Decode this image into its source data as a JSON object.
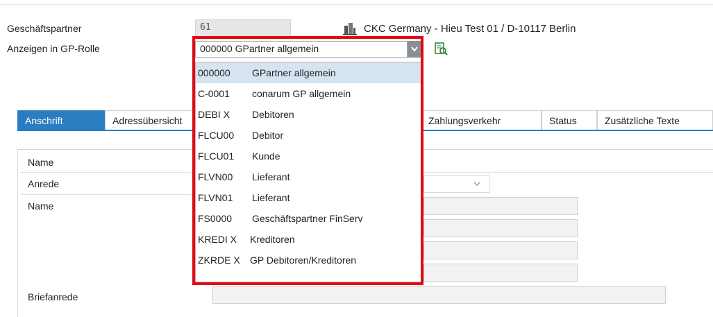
{
  "header": {
    "partner_label": "Geschäftspartner",
    "partner_value": "61",
    "partner_name": "CKC Germany - Hieu Test 01 / D-10117 Berlin",
    "role_label": "Anzeigen in GP-Rolle",
    "role_selected": "000000 GPartner allgemein"
  },
  "dropdown": {
    "options": [
      {
        "code": "000000",
        "text": "GPartner allgemein"
      },
      {
        "code": "C-0001",
        "text": "conarum GP allgemein"
      },
      {
        "code": "DEBI X",
        "text": "Debitoren"
      },
      {
        "code": "FLCU00",
        "text": "Debitor"
      },
      {
        "code": "FLCU01",
        "text": "Kunde"
      },
      {
        "code": "FLVN00",
        "text": "Lieferant"
      },
      {
        "code": "FLVN01",
        "text": "Lieferant"
      },
      {
        "code": "FS0000",
        "text": "Geschäftspartner FinServ"
      },
      {
        "code": "KREDI X",
        "text": "Kreditoren"
      },
      {
        "code": "ZKRDE X",
        "text": "GP Debitoren/Kreditoren"
      }
    ]
  },
  "tabs": [
    {
      "label": "Anschrift",
      "active": true
    },
    {
      "label": "Adressübersicht"
    },
    {
      "label": "Zahlungsverkehr"
    },
    {
      "label": "Status"
    },
    {
      "label": "Zusätzliche Texte"
    }
  ],
  "form": {
    "section_title": "Name",
    "anrede_label": "Anrede",
    "name_label": "Name",
    "briefanrede_label": "Briefanrede"
  },
  "colors": {
    "accent": "#2a7dc0",
    "highlight": "#e30613"
  }
}
